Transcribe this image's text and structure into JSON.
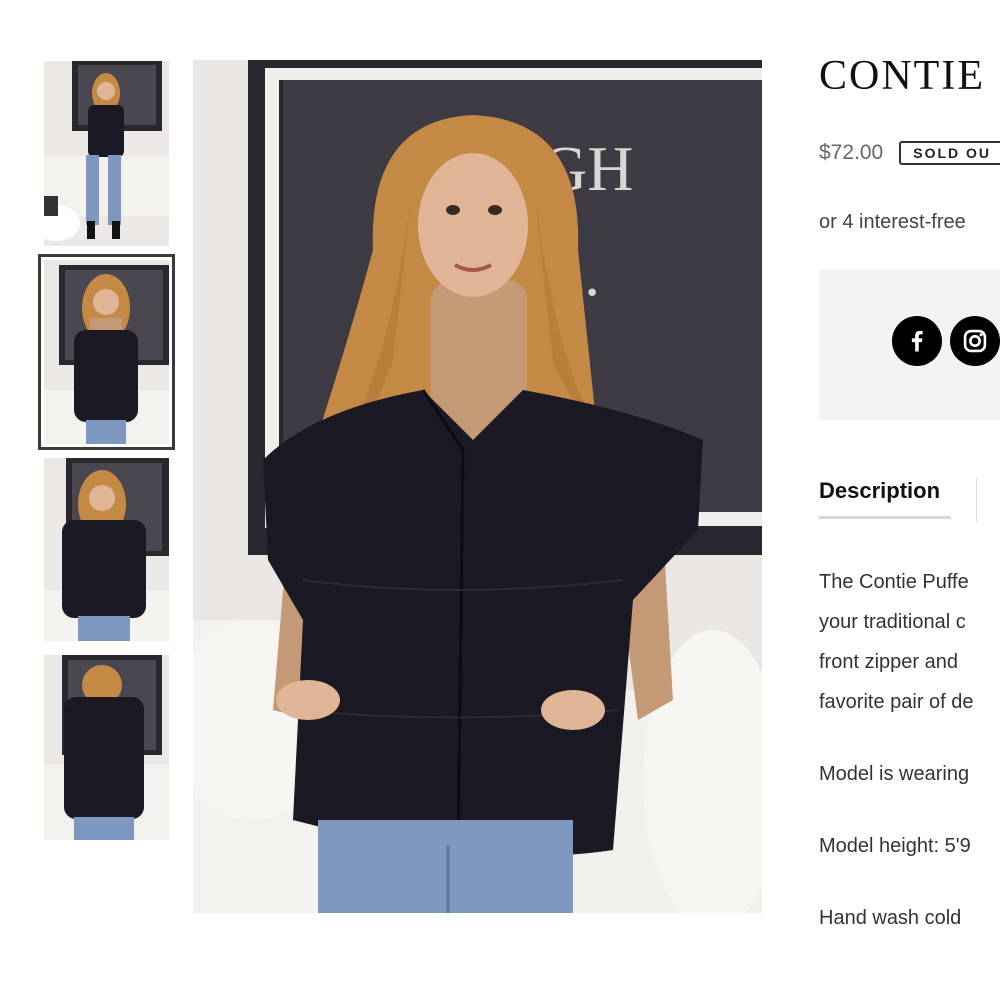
{
  "gallery": {
    "thumbnails": [
      {
        "alt": "Front view full length",
        "selected": false
      },
      {
        "alt": "Front view hands in pockets",
        "selected": true
      },
      {
        "alt": "Three-quarter view",
        "selected": false
      },
      {
        "alt": "Back view",
        "selected": false
      }
    ],
    "wall_text": [
      "GH",
      "E."
    ]
  },
  "product": {
    "title": "CONTIE",
    "price": "$72.00",
    "badge": "SOLD OU",
    "installments": "or 4 interest-free",
    "share": {
      "facebook": "facebook-icon",
      "instagram": "instagram-icon"
    },
    "tabs": {
      "description": "Description"
    },
    "description_lines": [
      "The Contie Puffe",
      "your traditional c",
      "front zipper and",
      "favorite pair of de"
    ],
    "details": [
      "Model is wearing",
      "Model height: 5'9",
      "Hand wash cold"
    ]
  },
  "colors": {
    "vest": "#1b1a24",
    "sweater": "#c49a76",
    "hair": "#c48a45",
    "jeans": "#7e98bf",
    "wall": "#e9e6e3",
    "frame": "#2a2730"
  }
}
